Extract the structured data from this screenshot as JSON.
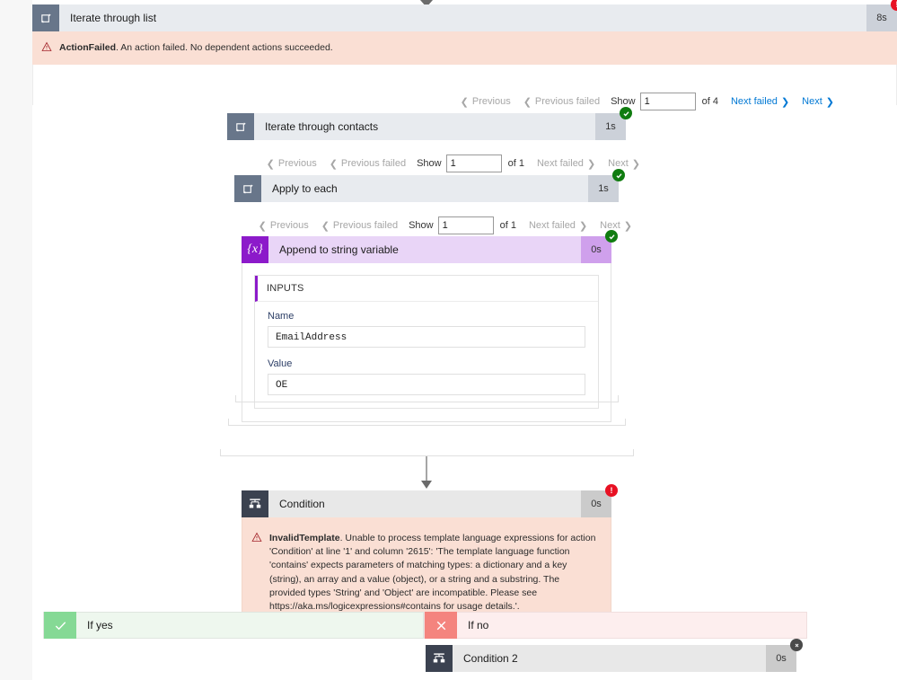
{
  "top_action": {
    "title": "Iterate through list",
    "duration": "8s",
    "status": "error",
    "icon": "foreach-loop-icon",
    "error": {
      "code": "ActionFailed",
      "message": "An action failed. No dependent actions succeeded."
    }
  },
  "pagers": [
    {
      "previous": "Previous",
      "previous_failed": "Previous failed",
      "show_label": "Show",
      "page_value": "1",
      "of_label": "of 4",
      "next_failed": "Next failed",
      "next": "Next",
      "next_active": true
    },
    {
      "previous": "Previous",
      "previous_failed": "Previous failed",
      "show_label": "Show",
      "page_value": "1",
      "of_label": "of 1",
      "next_failed": "Next failed",
      "next": "Next",
      "next_active": false
    },
    {
      "previous": "Previous",
      "previous_failed": "Previous failed",
      "show_label": "Show",
      "page_value": "1",
      "of_label": "of 1",
      "next_failed": "Next failed",
      "next": "Next",
      "next_active": false
    }
  ],
  "iterate_contacts": {
    "title": "Iterate through contacts",
    "duration": "1s",
    "status": "success",
    "icon": "foreach-loop-icon"
  },
  "apply_to_each": {
    "title": "Apply to each",
    "duration": "1s",
    "status": "success",
    "icon": "foreach-loop-icon"
  },
  "append_variable": {
    "title": "Append to string variable",
    "duration": "0s",
    "status": "success",
    "icon": "variable-braces-icon",
    "inputs_label": "INPUTS",
    "fields": [
      {
        "label": "Name",
        "value": "EmailAddress"
      },
      {
        "label": "Value",
        "value": "OE"
      }
    ]
  },
  "condition": {
    "title": "Condition",
    "duration": "0s",
    "status": "error",
    "icon": "condition-branch-icon",
    "error": {
      "code": "InvalidTemplate",
      "message": ". Unable to process template language expressions for action 'Condition' at line '1' and column '2615': 'The template language function 'contains' expects parameters of matching types: a dictionary and a key (string), an array and a value (object), or a string and a substring. The provided types 'String' and 'Object' are incompatible. Please see https://aka.ms/logicexpressions#contains for usage details.'."
    }
  },
  "branches": {
    "yes_label": "If yes",
    "no_label": "If no",
    "yes_icon": "check-icon",
    "no_icon": "x-icon",
    "condition2": {
      "title": "Condition 2",
      "duration": "0s",
      "status": "skipped",
      "icon": "condition-branch-icon"
    }
  },
  "colors": {
    "error_strip": "#fadfd4",
    "success_badge": "#107c10",
    "error_badge": "#e81123",
    "skipped_badge": "#4a4a4a",
    "loop_header": "#e8ebef",
    "variable_header": "#e9d5f7",
    "accent_link": "#0078d4"
  }
}
